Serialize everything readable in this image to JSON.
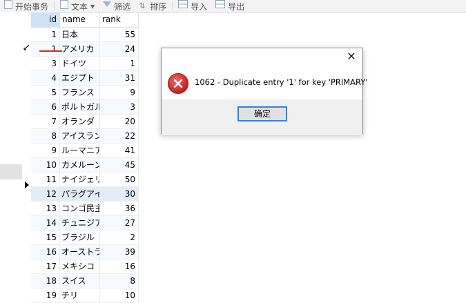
{
  "toolbar": {
    "begin_tx": "开始事务",
    "text": "文本",
    "filter": "筛选",
    "sort": "排序",
    "import": "导入",
    "export": "导出"
  },
  "table": {
    "columns": [
      "id",
      "name",
      "rank"
    ],
    "rows": [
      {
        "id": "1",
        "name": "日本",
        "rank": "55"
      },
      {
        "id": "1",
        "name": "アメリカ",
        "rank": "24"
      },
      {
        "id": "3",
        "name": "ドイツ",
        "rank": "1"
      },
      {
        "id": "4",
        "name": "エジプト",
        "rank": "31"
      },
      {
        "id": "5",
        "name": "フランス",
        "rank": "9"
      },
      {
        "id": "6",
        "name": "ポルトガル",
        "rank": "3"
      },
      {
        "id": "7",
        "name": "オランダ",
        "rank": "20"
      },
      {
        "id": "8",
        "name": "アイスランド",
        "rank": "22"
      },
      {
        "id": "9",
        "name": "ルーマニア",
        "rank": "41"
      },
      {
        "id": "10",
        "name": "カメルーン",
        "rank": "45"
      },
      {
        "id": "11",
        "name": "ナイジェリア",
        "rank": "50"
      },
      {
        "id": "12",
        "name": "パラグアイ",
        "rank": "30"
      },
      {
        "id": "13",
        "name": "コンゴ民主共",
        "rank": "36"
      },
      {
        "id": "14",
        "name": "チュニジア",
        "rank": "27"
      },
      {
        "id": "15",
        "name": "ブラジル",
        "rank": "2"
      },
      {
        "id": "16",
        "name": "オーストラリア",
        "rank": "39"
      },
      {
        "id": "17",
        "name": "メキシコ",
        "rank": "16"
      },
      {
        "id": "18",
        "name": "スイス",
        "rank": "8"
      },
      {
        "id": "19",
        "name": "チリ",
        "rank": "10"
      }
    ]
  },
  "dialog": {
    "close": "✕",
    "message": "1062 - Duplicate entry '1' for key 'PRIMARY'",
    "ok_label": "确定"
  },
  "colors": {
    "error_red": "#c81f1f",
    "button_focus": "#3b7fd6",
    "header_selected": "#cfe3f7"
  }
}
